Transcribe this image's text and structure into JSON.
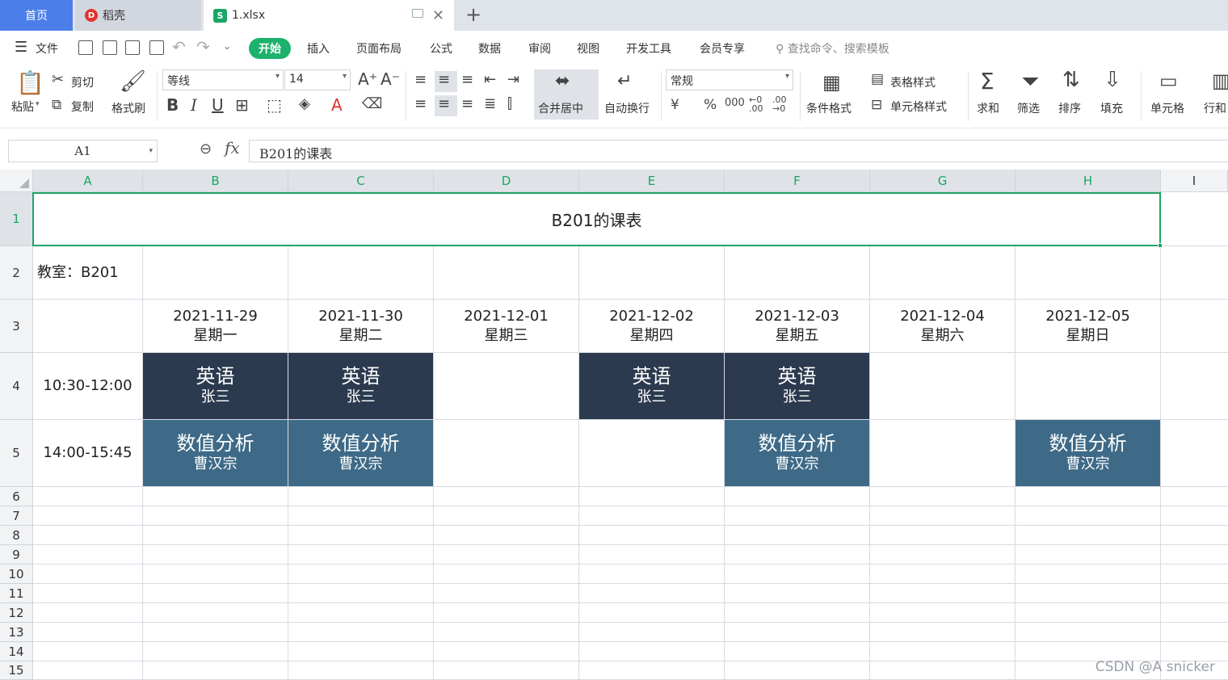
{
  "tabs": {
    "home": "首页",
    "daoke": "稻壳",
    "file": "1.xlsx"
  },
  "menu": {
    "file": "文件",
    "items": [
      "开始",
      "插入",
      "页面布局",
      "公式",
      "数据",
      "审阅",
      "视图",
      "开发工具",
      "会员专享"
    ],
    "search_placeholder": "查找命令、搜索模板"
  },
  "ribbon": {
    "paste": "粘贴",
    "cut": "剪切",
    "copy": "复制",
    "format_painter": "格式刷",
    "font_name": "等线",
    "font_size": "14",
    "merge_center": "合并居中",
    "wrap_text": "自动换行",
    "number_format": "常规",
    "conditional_format": "条件格式",
    "table_style": "表格样式",
    "cell_style": "单元格样式",
    "sum": "求和",
    "filter": "筛选",
    "sort": "排序",
    "fill": "填充",
    "cell": "单元格",
    "rowcol": "行和"
  },
  "formula_bar": {
    "name_box": "A1",
    "fx": "fx",
    "content": "B201的课表"
  },
  "sheet": {
    "columns": [
      "A",
      "B",
      "C",
      "D",
      "E",
      "F",
      "G",
      "H",
      "I"
    ],
    "rows": [
      "1",
      "2",
      "3",
      "4",
      "5",
      "6",
      "7",
      "8",
      "9",
      "10",
      "11",
      "12",
      "13",
      "14",
      "15"
    ],
    "title": "B201的课表",
    "classroom": "教室：B201",
    "dates": [
      {
        "date": "2021-11-29",
        "weekday": "星期一"
      },
      {
        "date": "2021-11-30",
        "weekday": "星期二"
      },
      {
        "date": "2021-12-01",
        "weekday": "星期三"
      },
      {
        "date": "2021-12-02",
        "weekday": "星期四"
      },
      {
        "date": "2021-12-03",
        "weekday": "星期五"
      },
      {
        "date": "2021-12-04",
        "weekday": "星期六"
      },
      {
        "date": "2021-12-05",
        "weekday": "星期日"
      }
    ],
    "slots": [
      {
        "time": "10:30-12:00",
        "cells": [
          {
            "course": "英语",
            "teacher": "张三"
          },
          {
            "course": "英语",
            "teacher": "张三"
          },
          {
            "course": "",
            "teacher": ""
          },
          {
            "course": "英语",
            "teacher": "张三"
          },
          {
            "course": "英语",
            "teacher": "张三"
          },
          {
            "course": "",
            "teacher": ""
          },
          {
            "course": "",
            "teacher": ""
          }
        ]
      },
      {
        "time": "14:00-15:45",
        "cells": [
          {
            "course": "数值分析",
            "teacher": "曹汉宗"
          },
          {
            "course": "数值分析",
            "teacher": "曹汉宗"
          },
          {
            "course": "",
            "teacher": ""
          },
          {
            "course": "",
            "teacher": ""
          },
          {
            "course": "数值分析",
            "teacher": "曹汉宗"
          },
          {
            "course": "",
            "teacher": ""
          },
          {
            "course": "数值分析",
            "teacher": "曹汉宗"
          }
        ]
      }
    ],
    "colors": {
      "english": "#2b3a4e",
      "numerical_analysis": "#3e6a88",
      "selection": "#21a366"
    }
  },
  "watermark": "CSDN @A snicker"
}
